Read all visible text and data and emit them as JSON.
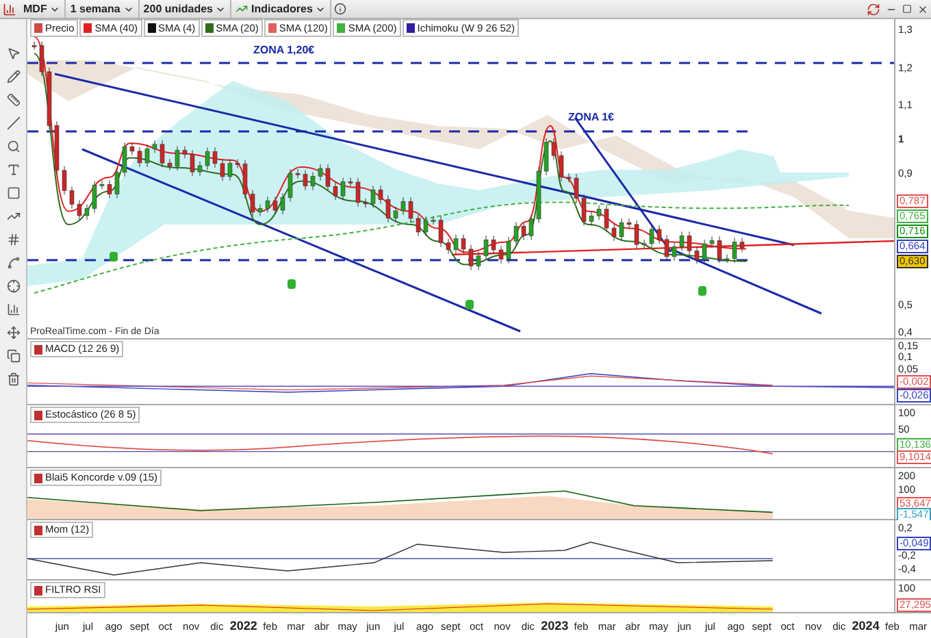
{
  "toolbar": {
    "instrument": "MDF",
    "period": "1 semana",
    "units": "200 unidades",
    "indicators": "Indicadores"
  },
  "legend": [
    {
      "label": "Precio",
      "color": "#d04848"
    },
    {
      "label": "SMA (40)",
      "color": "#e02020"
    },
    {
      "label": "SMA (4)",
      "color": "#101010"
    },
    {
      "label": "SMA (20)",
      "color": "#2e6e1e"
    },
    {
      "label": "SMA (120)",
      "color": "#e06060"
    },
    {
      "label": "SMA (200)",
      "color": "#40b040"
    },
    {
      "label": "Ichimoku (W 9 26 52)",
      "color": "#3020a0"
    }
  ],
  "main_chart": {
    "source": "ProRealTime.com - Fin de Día",
    "annotations": [
      "ZONA 1,20€",
      "ZONA 1€"
    ],
    "axis": [
      "1,3",
      "1,2",
      "1,1",
      "1",
      "0,9",
      "0,5",
      "0,4"
    ],
    "value_labels": [
      {
        "text": "0,787",
        "color": "#e05050",
        "highlighted": false
      },
      {
        "text": "0,765",
        "color": "#40b040",
        "highlighted": false
      },
      {
        "text": "0,716",
        "color": "#109010",
        "highlighted": false
      },
      {
        "text": "0,664",
        "color": "#3040c0",
        "highlighted": false
      },
      {
        "text": "0,630",
        "color": "#303030",
        "highlighted": true
      }
    ]
  },
  "panels": [
    {
      "kind": "macd",
      "title": "MACD (12 26 9)",
      "axis": [
        "0,15",
        "0,1",
        "0,05"
      ],
      "value_labels": [
        {
          "text": "-0,002",
          "color": "#e05050"
        },
        {
          "text": "-0,026",
          "color": "#3040c0"
        }
      ]
    },
    {
      "kind": "stochastic",
      "title": "Estocástico (26 8 5)",
      "axis": [
        "100",
        "50"
      ],
      "value_labels": [
        {
          "text": "10,136",
          "color": "#40b040"
        },
        {
          "text": "9,1014",
          "color": "#e05050"
        }
      ]
    },
    {
      "kind": "koncorde",
      "title": "Blai5 Koncorde v.09 (15)",
      "axis": [
        "200",
        "100"
      ],
      "value_labels": [
        {
          "text": "53,647",
          "color": "#e05050"
        },
        {
          "text": "-1,547",
          "color": "#30a0c0"
        }
      ]
    },
    {
      "kind": "momentum",
      "title": "Mom (12)",
      "axis": [
        "0,2",
        "-0,2",
        "-0,4"
      ],
      "value_labels": [
        {
          "text": "-0,049",
          "color": "#3040c0"
        }
      ]
    },
    {
      "kind": "rsi",
      "title": "FILTRO RSI",
      "axis": [
        "100"
      ],
      "value_labels": [
        {
          "text": "27,295",
          "color": "#e05050"
        }
      ]
    }
  ],
  "time_axis": [
    {
      "label": "jun",
      "kind": "month"
    },
    {
      "label": "jul",
      "kind": "month"
    },
    {
      "label": "ago",
      "kind": "month"
    },
    {
      "label": "sept",
      "kind": "month"
    },
    {
      "label": "oct",
      "kind": "month"
    },
    {
      "label": "nov",
      "kind": "month"
    },
    {
      "label": "dic",
      "kind": "month"
    },
    {
      "label": "2022",
      "kind": "year"
    },
    {
      "label": "feb",
      "kind": "month"
    },
    {
      "label": "mar",
      "kind": "month"
    },
    {
      "label": "abr",
      "kind": "month"
    },
    {
      "label": "may",
      "kind": "month"
    },
    {
      "label": "jun",
      "kind": "month"
    },
    {
      "label": "jul",
      "kind": "month"
    },
    {
      "label": "ago",
      "kind": "month"
    },
    {
      "label": "sept",
      "kind": "month"
    },
    {
      "label": "oct",
      "kind": "month"
    },
    {
      "label": "nov",
      "kind": "month"
    },
    {
      "label": "dic",
      "kind": "month"
    },
    {
      "label": "2023",
      "kind": "year"
    },
    {
      "label": "feb",
      "kind": "month"
    },
    {
      "label": "mar",
      "kind": "month"
    },
    {
      "label": "abr",
      "kind": "month"
    },
    {
      "label": "may",
      "kind": "month"
    },
    {
      "label": "jun",
      "kind": "month"
    },
    {
      "label": "jul",
      "kind": "month"
    },
    {
      "label": "ago",
      "kind": "month"
    },
    {
      "label": "sept",
      "kind": "month"
    },
    {
      "label": "oct",
      "kind": "month"
    },
    {
      "label": "nov",
      "kind": "month"
    },
    {
      "label": "dic",
      "kind": "month"
    },
    {
      "label": "2024",
      "kind": "year"
    },
    {
      "label": "feb",
      "kind": "month"
    },
    {
      "label": "mar",
      "kind": "month"
    }
  ]
}
